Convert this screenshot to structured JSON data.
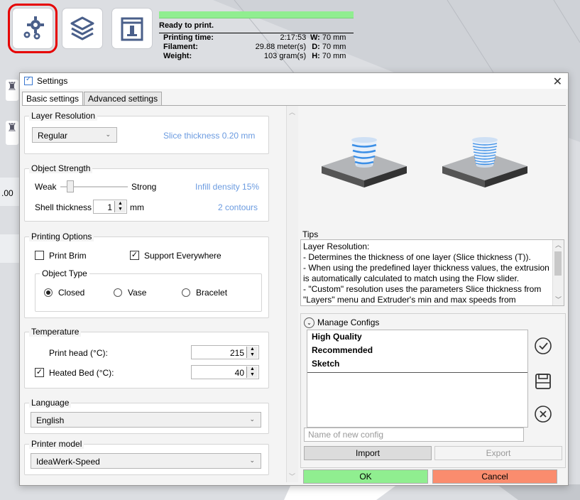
{
  "toolbar": {
    "settings_icon": "gear-icon",
    "layers_icon": "layers-icon",
    "printer_icon": "printer-icon"
  },
  "print_info": {
    "status": "Ready to print.",
    "time_label": "Printing time:",
    "time_value": "2:17:53",
    "filament_label": "Filament:",
    "filament_value": "29.88 meter(s)",
    "weight_label": "Weight:",
    "weight_value": "103 gram(s)",
    "w_label": "W:",
    "w_value": "70 mm",
    "d_label": "D:",
    "d_value": "70 mm",
    "h_label": "H:",
    "h_value": "70 mm",
    "side_value": ".00"
  },
  "dialog": {
    "title": "Settings",
    "close": "✕",
    "tabs": [
      "Basic settings",
      "Advanced settings"
    ]
  },
  "layer_resolution": {
    "legend": "Layer Resolution",
    "selected": "Regular",
    "info": "Slice thickness 0.20 mm"
  },
  "object_strength": {
    "legend": "Object Strength",
    "weak": "Weak",
    "strong": "Strong",
    "slider_level": 0.15,
    "infill": "Infill density 15%",
    "shell_label": "Shell thickness",
    "shell_value": "1",
    "shell_unit": "mm",
    "contours": "2 contours"
  },
  "printing_options": {
    "legend": "Printing Options",
    "print_brim": "Print Brim",
    "print_brim_checked": false,
    "support": "Support Everywhere",
    "support_checked": true,
    "object_type_legend": "Object Type",
    "types": [
      "Closed",
      "Vase",
      "Bracelet"
    ],
    "selected_type": "Closed"
  },
  "temperature": {
    "legend": "Temperature",
    "head_label": "Print head (°C):",
    "head_value": "215",
    "bed_label": "Heated Bed (°C):",
    "bed_value": "40",
    "bed_checked": true
  },
  "language": {
    "legend": "Language",
    "selected": "English"
  },
  "printer_model": {
    "legend": "Printer model",
    "selected": "IdeaWerk-Speed"
  },
  "tips": {
    "legend": "Tips",
    "lines": [
      "Layer Resolution:",
      "- Determines the thickness of one layer (Slice thickness (T)).",
      "- When using the predefined layer thickness values, the extrusion",
      "is automatically calculated to match using the Flow slider.",
      "- \"Custom\" resolution uses the parameters Slice thickness from",
      "\"Layers\" menu and Extruder's min and max speeds from Extruder-"
    ]
  },
  "manage_configs": {
    "title": "Manage Configs",
    "items": [
      "High Quality",
      "Recommended",
      "Sketch"
    ],
    "name_placeholder": "Name of new config",
    "import": "Import",
    "export": "Export"
  },
  "footer": {
    "ok": "OK",
    "cancel": "Cancel"
  },
  "colors": {
    "ok_bg": "#90ee90",
    "cancel_bg": "#fa8c6e",
    "accent_blue": "#6b9be0",
    "highlight_red": "#e60000"
  }
}
